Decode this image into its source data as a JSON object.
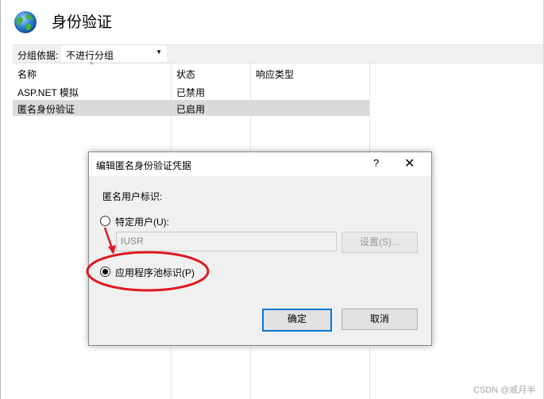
{
  "header": {
    "title": "身份验证",
    "icon": "globe-icon"
  },
  "group_by": {
    "label": "分组依据:",
    "value": "不进行分组"
  },
  "table": {
    "columns": [
      "名称",
      "状态",
      "响应类型"
    ],
    "rows": [
      {
        "name": "ASP.NET 模拟",
        "status": "已禁用",
        "response": ""
      },
      {
        "name": "匿名身份验证",
        "status": "已启用",
        "response": "",
        "selected": true
      }
    ]
  },
  "dialog": {
    "title": "编辑匿名身份验证凭据",
    "help": "?",
    "close": "✕",
    "identity_label": "匿名用户标识:",
    "option_specific": "特定用户(U):",
    "username_value": "IUSR",
    "set_button": "设置(S)...",
    "option_apppool": "应用程序池标识(P)",
    "selected_option": "apppool",
    "ok_button": "确定",
    "cancel_button": "取消"
  },
  "annotation": {
    "color": "#e0191f"
  },
  "watermark": "CSDN @戚月半"
}
